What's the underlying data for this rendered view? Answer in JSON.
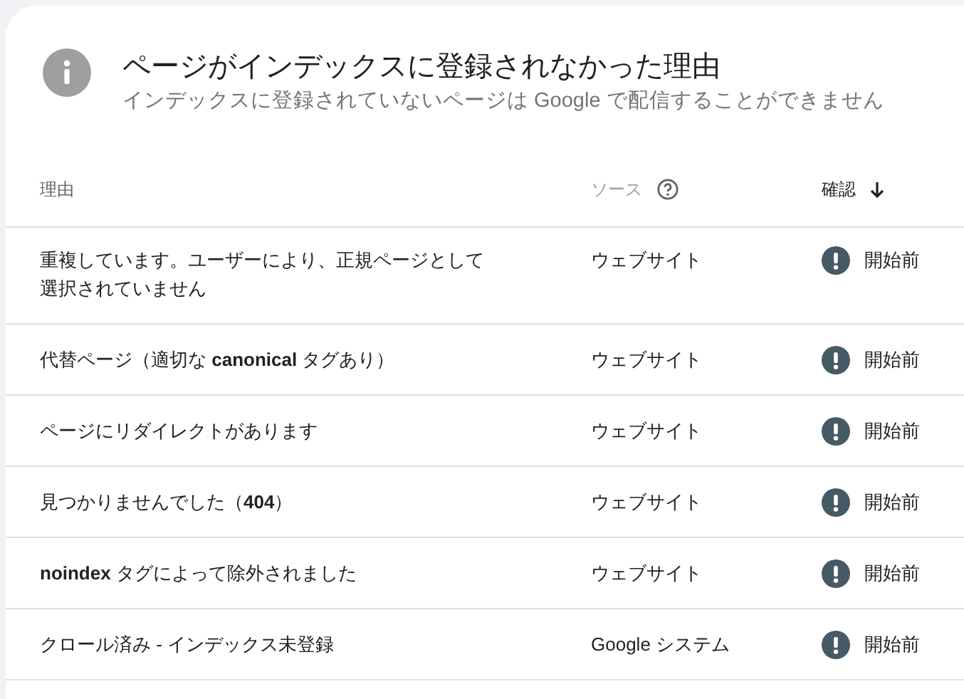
{
  "header": {
    "title": "ページがインデックスに登録されなかった理由",
    "subtitle": "インデックスに登録されていないページは Google で配信することができません"
  },
  "table": {
    "columns": [
      {
        "label": "理由",
        "sorted": false,
        "help": false
      },
      {
        "label": "ソース",
        "sorted": false,
        "help": true
      },
      {
        "label": "確認",
        "sorted": true,
        "help": false
      }
    ],
    "rows": [
      {
        "reason": "重複しています。ユーザーにより、正規ページとして選択されていません",
        "source": "ウェブサイト",
        "status": "開始前"
      },
      {
        "reason": "代替ページ（適切な **canonical** タグあり）",
        "source": "ウェブサイト",
        "status": "開始前"
      },
      {
        "reason": "ページにリダイレクトがあります",
        "source": "ウェブサイト",
        "status": "開始前"
      },
      {
        "reason": "見つかりませんでした（**404**）",
        "source": "ウェブサイト",
        "status": "開始前"
      },
      {
        "reason": "**noindex** タグによって除外されました",
        "source": "ウェブサイト",
        "status": "開始前"
      },
      {
        "reason": "クロール済み - インデックス未登録",
        "source": "Google システム",
        "status": "開始前"
      }
    ]
  }
}
